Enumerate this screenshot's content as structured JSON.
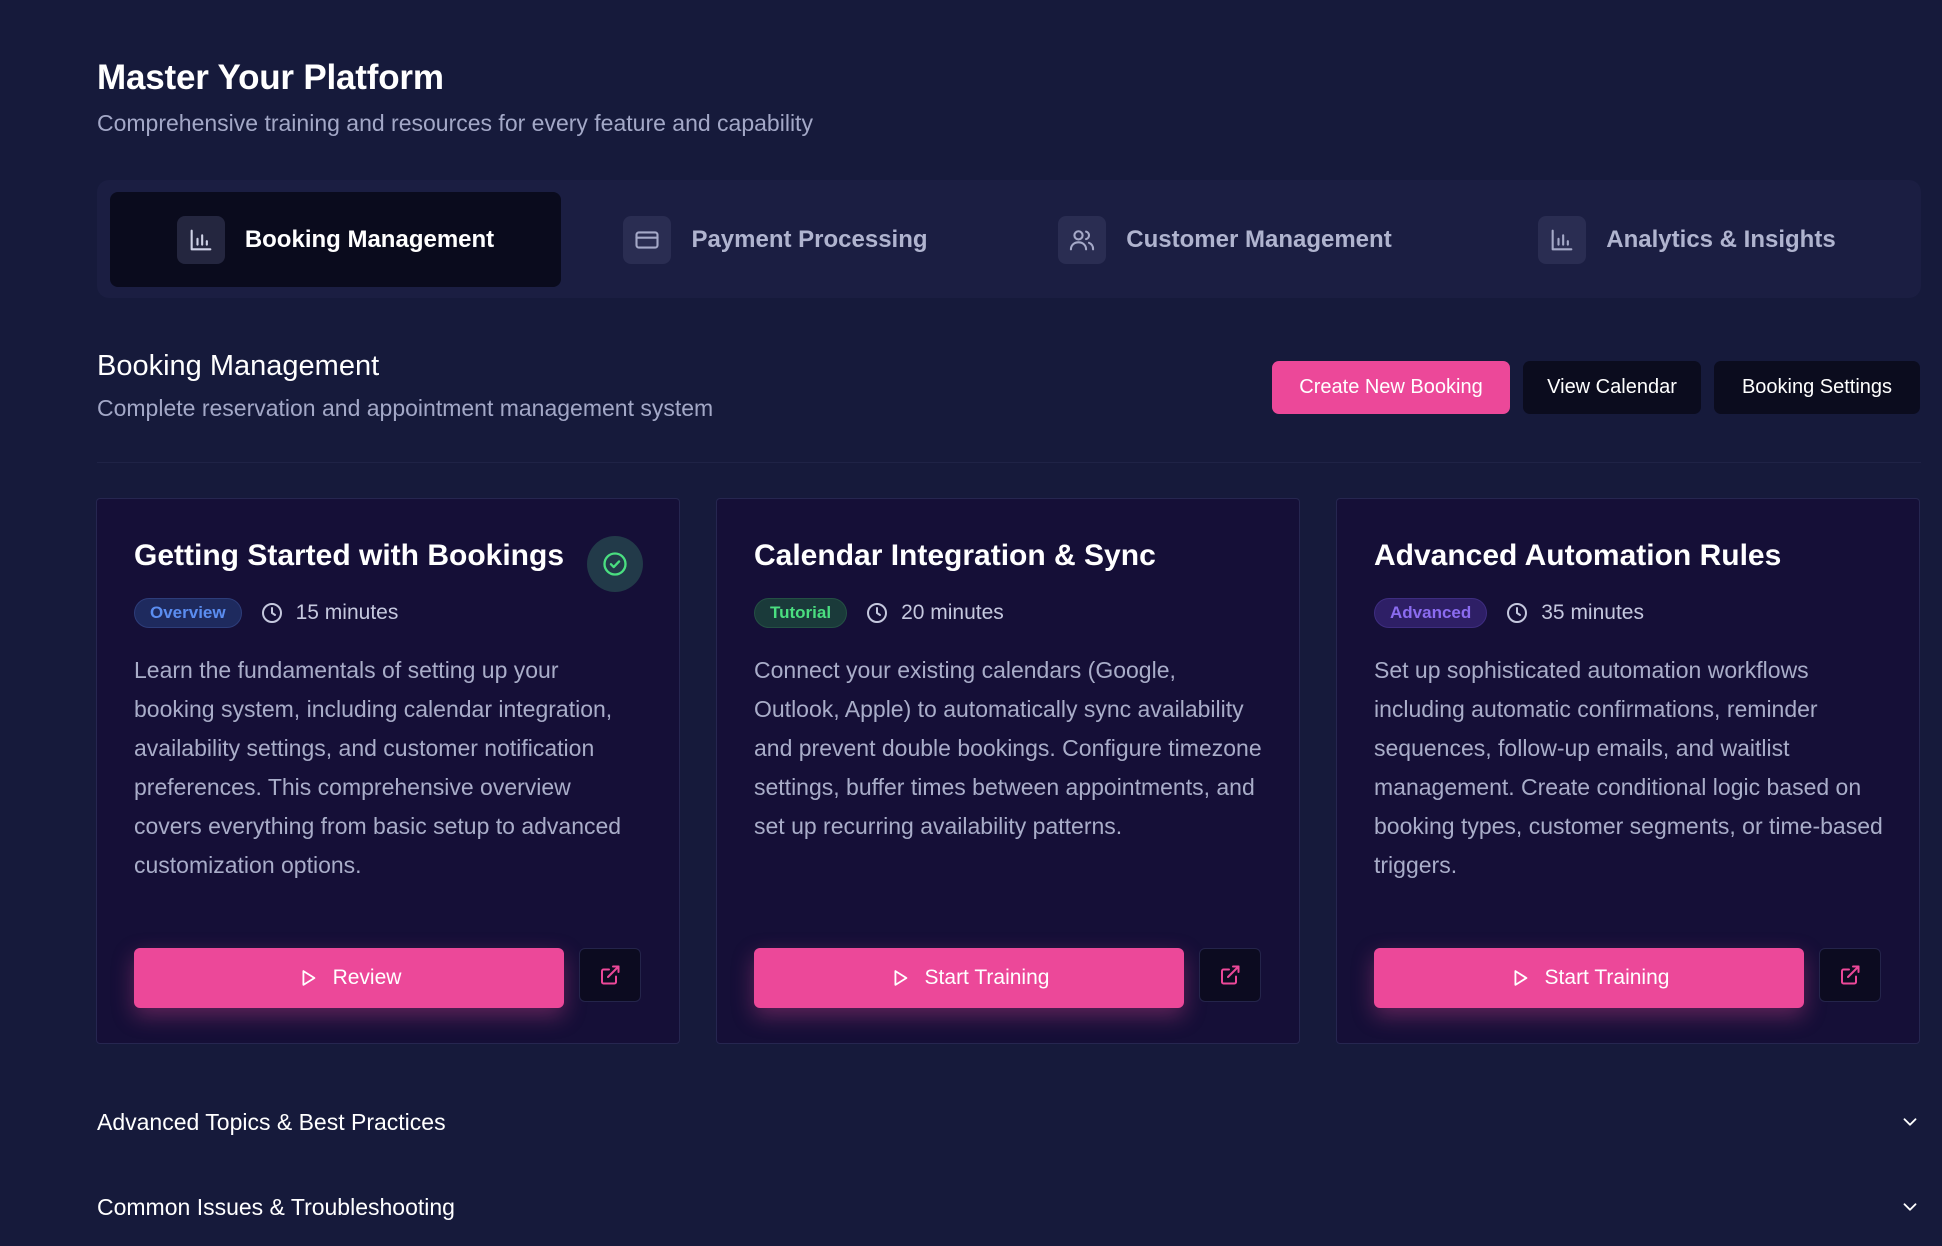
{
  "hero": {
    "title": "Master Your Platform",
    "subtitle": "Comprehensive training and resources for every feature and capability"
  },
  "tabs": [
    {
      "label": "Booking Management",
      "icon": "bar-chart-icon",
      "active": true
    },
    {
      "label": "Payment Processing",
      "icon": "credit-card-icon",
      "active": false
    },
    {
      "label": "Customer Management",
      "icon": "users-icon",
      "active": false
    },
    {
      "label": "Analytics & Insights",
      "icon": "bar-chart-icon",
      "active": false
    }
  ],
  "section": {
    "title": "Booking Management",
    "subtitle": "Complete reservation and appointment management system",
    "actions": {
      "create": "Create New Booking",
      "calendar": "View Calendar",
      "settings": "Booking Settings"
    }
  },
  "cards": [
    {
      "title": "Getting Started with Bookings",
      "tag": "Overview",
      "duration": "15 minutes",
      "completed": true,
      "description": "Learn the fundamentals of setting up your booking system, including calendar integration, availability settings, and customer notification preferences. This comprehensive overview covers everything from basic setup to advanced customization options.",
      "cta": "Review"
    },
    {
      "title": "Calendar Integration & Sync",
      "tag": "Tutorial",
      "duration": "20 minutes",
      "completed": false,
      "description": "Connect your existing calendars (Google, Outlook, Apple) to automatically sync availability and prevent double bookings. Configure timezone settings, buffer times between appointments, and set up recurring availability patterns.",
      "cta": "Start Training"
    },
    {
      "title": "Advanced Automation Rules",
      "tag": "Advanced",
      "duration": "35 minutes",
      "completed": false,
      "description": "Set up sophisticated automation workflows including automatic confirmations, reminder sequences, follow-up emails, and waitlist management. Create conditional logic based on booking types, customer segments, or time-based triggers.",
      "cta": "Start Training"
    }
  ],
  "accordions": [
    {
      "label": "Advanced Topics & Best Practices"
    },
    {
      "label": "Common Issues & Troubleshooting"
    }
  ],
  "colors": {
    "background": "#161a3b",
    "accent": "#ec4899",
    "card": "#150f37",
    "success": "#4ade80"
  }
}
